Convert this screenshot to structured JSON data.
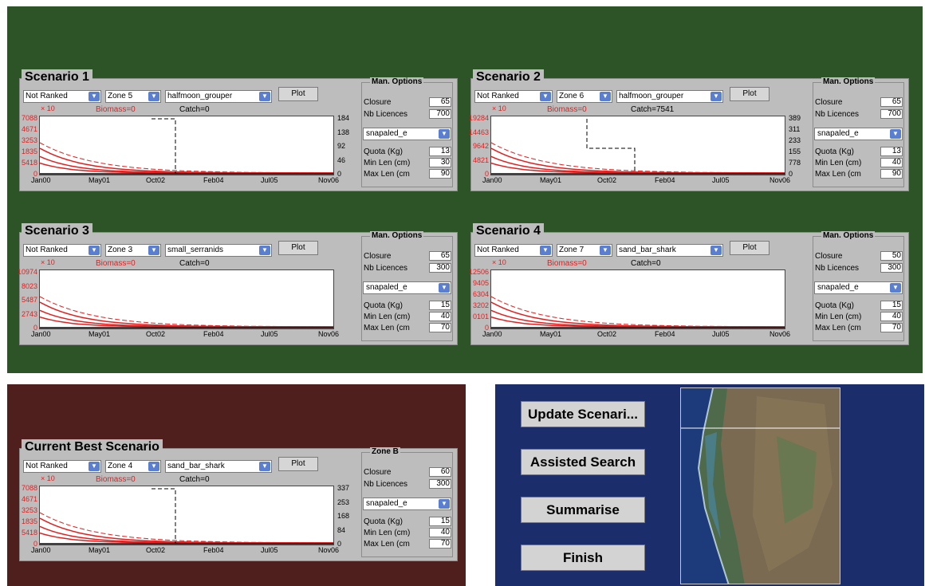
{
  "scenarios": [
    {
      "title": "Scenario 1",
      "rank": "Not Ranked",
      "zone": "Zone 5",
      "species": "halfmoon_grouper",
      "plot_label": "Plot",
      "exponent": "× 10",
      "biomass": "Biomass=0",
      "catch": "Catch=0",
      "y_labels": [
        "7088",
        "4671",
        "3253",
        "1835",
        "5418",
        "0"
      ],
      "r_labels": [
        "184",
        "138",
        "92",
        "46",
        "0"
      ],
      "options": {
        "title": "Man. Options",
        "closure_label": "Closure",
        "closure": "65",
        "licences_label": "Nb Licences",
        "licences": "700",
        "method": "snapaled_e",
        "quota_label": "Quota (Kg)",
        "quota": "13",
        "minlen_label": "Min Len (cm)",
        "minlen": "30",
        "maxlen_label": "Max Len (cm",
        "maxlen": "90"
      }
    },
    {
      "title": "Scenario 2",
      "rank": "Not Ranked",
      "zone": "Zone 6",
      "species": "halfmoon_grouper",
      "plot_label": "Plot",
      "exponent": "× 10",
      "biomass": "Biomass=0",
      "catch": "Catch=7541",
      "y_labels": [
        "19284",
        "14463",
        "9642",
        "4821",
        "0"
      ],
      "r_labels": [
        "389",
        "311",
        "233",
        "155",
        "778",
        "0"
      ],
      "options": {
        "title": "Man. Options",
        "closure_label": "Closure",
        "closure": "65",
        "licences_label": "Nb Licences",
        "licences": "700",
        "method": "snapaled_e",
        "quota_label": "Quota (Kg)",
        "quota": "13",
        "minlen_label": "Min Len (cm)",
        "minlen": "40",
        "maxlen_label": "Max Len (cm",
        "maxlen": "90"
      }
    },
    {
      "title": "Scenario 3",
      "rank": "Not Ranked",
      "zone": "Zone 3",
      "species": "small_serranids",
      "plot_label": "Plot",
      "exponent": "× 10",
      "biomass": "Biomass=0",
      "catch": "Catch=0",
      "y_labels": [
        "10974",
        "8023",
        "5487",
        "2743",
        "0"
      ],
      "r_labels": [],
      "options": {
        "title": "Man. Options",
        "closure_label": "Closure",
        "closure": "65",
        "licences_label": "Nb Licences",
        "licences": "300",
        "method": "snapaled_e",
        "quota_label": "Quota (Kg)",
        "quota": "15",
        "minlen_label": "Min Len (cm)",
        "minlen": "40",
        "maxlen_label": "Max Len (cm",
        "maxlen": "70"
      }
    },
    {
      "title": "Scenario 4",
      "rank": "Not Ranked",
      "zone": "Zone 7",
      "species": "sand_bar_shark",
      "plot_label": "Plot",
      "exponent": "× 10",
      "biomass": "Biomass=0",
      "catch": "Catch=0",
      "y_labels": [
        "12506",
        "9405",
        "6304",
        "3202",
        "0101",
        "0"
      ],
      "r_labels": [],
      "options": {
        "title": "Man. Options",
        "closure_label": "Closure",
        "closure": "50",
        "licences_label": "Nb Licences",
        "licences": "300",
        "method": "snapaled_e",
        "quota_label": "Quota (Kg)",
        "quota": "15",
        "minlen_label": "Min Len (cm)",
        "minlen": "40",
        "maxlen_label": "Max Len (cm",
        "maxlen": "70"
      }
    }
  ],
  "best": {
    "title": "Current Best Scenario",
    "rank": "Not Ranked",
    "zone": "Zone 4",
    "species": "sand_bar_shark",
    "plot_label": "Plot",
    "exponent": "× 10",
    "biomass": "Biomass=0",
    "catch": "Catch=0",
    "y_labels": [
      "7088",
      "4671",
      "3253",
      "1835",
      "5418",
      "0"
    ],
    "r_labels": [
      "337",
      "253",
      "168",
      "84",
      "0"
    ],
    "options": {
      "title": "Zone B",
      "closure_label": "Closure",
      "closure": "60",
      "licences_label": "Nb Licences",
      "licences": "300",
      "method": "snapaled_e",
      "quota_label": "Quota (Kg)",
      "quota": "15",
      "minlen_label": "Min Len (cm)",
      "minlen": "40",
      "maxlen_label": "Max Len (cm",
      "maxlen": "70"
    }
  },
  "x_labels": [
    "Jan00",
    "May01",
    "Oct02",
    "Feb04",
    "Jul05",
    "Nov06"
  ],
  "actions": {
    "update": "Update Scenari...",
    "assisted": "Assisted Search",
    "summarise": "Summarise",
    "finish": "Finish"
  },
  "colors": {
    "green": "#2c5426",
    "maroon": "#4e1f1c",
    "navy": "#1c2d6b",
    "panel": "#bdbdbd",
    "series": "#e02020"
  }
}
